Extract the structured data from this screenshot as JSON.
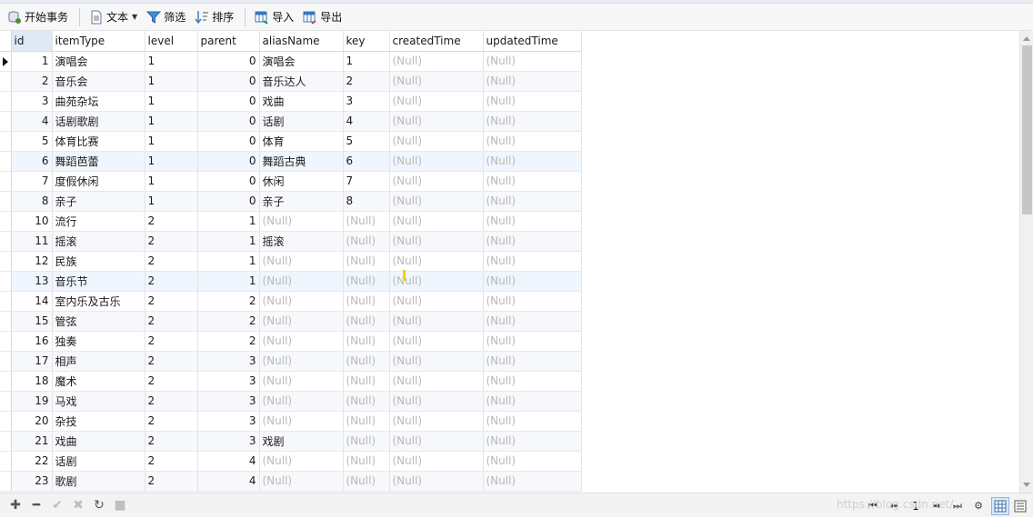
{
  "toolbar": {
    "begin_transaction": "开始事务",
    "text": "文本",
    "filter": "筛选",
    "sort": "排序",
    "import": "导入",
    "export": "导出"
  },
  "grid": {
    "columns": [
      "id",
      "itemType",
      "level",
      "parent",
      "aliasName",
      "key",
      "createdTime",
      "updatedTime"
    ],
    "null_text": "(Null)",
    "rows": [
      {
        "id": "1",
        "itemType": "演唱会",
        "level": "1",
        "parent": "0",
        "aliasName": "演唱会",
        "key": "1"
      },
      {
        "id": "2",
        "itemType": "音乐会",
        "level": "1",
        "parent": "0",
        "aliasName": "音乐达人",
        "key": "2"
      },
      {
        "id": "3",
        "itemType": "曲苑杂坛",
        "level": "1",
        "parent": "0",
        "aliasName": "戏曲",
        "key": "3"
      },
      {
        "id": "4",
        "itemType": "话剧歌剧",
        "level": "1",
        "parent": "0",
        "aliasName": "话剧",
        "key": "4"
      },
      {
        "id": "5",
        "itemType": "体育比赛",
        "level": "1",
        "parent": "0",
        "aliasName": "体育",
        "key": "5"
      },
      {
        "id": "6",
        "itemType": "舞蹈芭蕾",
        "level": "1",
        "parent": "0",
        "aliasName": "舞蹈古典",
        "key": "6"
      },
      {
        "id": "7",
        "itemType": "度假休闲",
        "level": "1",
        "parent": "0",
        "aliasName": "休闲",
        "key": "7"
      },
      {
        "id": "8",
        "itemType": "亲子",
        "level": "1",
        "parent": "0",
        "aliasName": "亲子",
        "key": "8"
      },
      {
        "id": "10",
        "itemType": "流行",
        "level": "2",
        "parent": "1",
        "aliasName": null,
        "key": null
      },
      {
        "id": "11",
        "itemType": "摇滚",
        "level": "2",
        "parent": "1",
        "aliasName": "摇滚",
        "key": null
      },
      {
        "id": "12",
        "itemType": "民族",
        "level": "2",
        "parent": "1",
        "aliasName": null,
        "key": null
      },
      {
        "id": "13",
        "itemType": "音乐节",
        "level": "2",
        "parent": "1",
        "aliasName": null,
        "key": null
      },
      {
        "id": "14",
        "itemType": "室内乐及古乐",
        "level": "2",
        "parent": "2",
        "aliasName": null,
        "key": null
      },
      {
        "id": "15",
        "itemType": "管弦",
        "level": "2",
        "parent": "2",
        "aliasName": null,
        "key": null
      },
      {
        "id": "16",
        "itemType": "独奏",
        "level": "2",
        "parent": "2",
        "aliasName": null,
        "key": null
      },
      {
        "id": "17",
        "itemType": "相声",
        "level": "2",
        "parent": "3",
        "aliasName": null,
        "key": null
      },
      {
        "id": "18",
        "itemType": "魔术",
        "level": "2",
        "parent": "3",
        "aliasName": null,
        "key": null
      },
      {
        "id": "19",
        "itemType": "马戏",
        "level": "2",
        "parent": "3",
        "aliasName": null,
        "key": null
      },
      {
        "id": "20",
        "itemType": "杂技",
        "level": "2",
        "parent": "3",
        "aliasName": null,
        "key": null
      },
      {
        "id": "21",
        "itemType": "戏曲",
        "level": "2",
        "parent": "3",
        "aliasName": "戏剧",
        "key": null
      },
      {
        "id": "22",
        "itemType": "话剧",
        "level": "2",
        "parent": "4",
        "aliasName": null,
        "key": null
      },
      {
        "id": "23",
        "itemType": "歌剧",
        "level": "2",
        "parent": "4",
        "aliasName": null,
        "key": null
      }
    ]
  },
  "statusbar": {
    "page": "1",
    "watermark": "https://blog.csdn.net/..."
  }
}
